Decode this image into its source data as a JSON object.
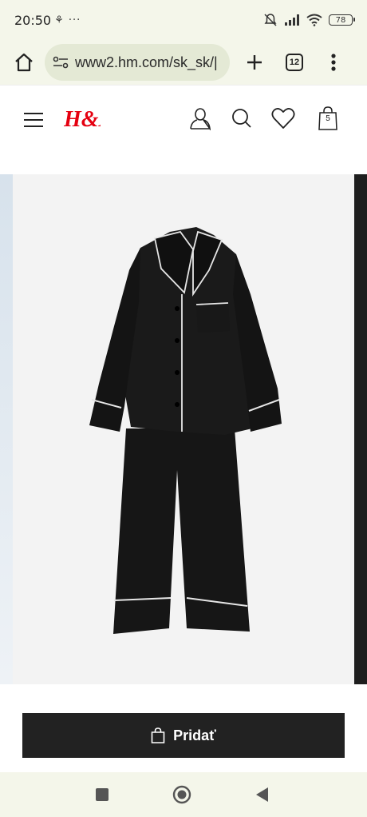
{
  "status": {
    "time": "20:50",
    "left_icons": "⚘ ···",
    "battery": "78",
    "icons": [
      "mute-icon",
      "signal-icon",
      "wifi-icon",
      "battery-icon"
    ]
  },
  "browser": {
    "url": "www2.hm.com/sk_sk/|",
    "tab_count": "12"
  },
  "header": {
    "logo_text": "H&M",
    "brand_color": "#e50010",
    "bag_count": "5"
  },
  "product": {
    "image_subject": "black satin pyjama set with white piping"
  },
  "actions": {
    "add_label": "Pridať"
  }
}
